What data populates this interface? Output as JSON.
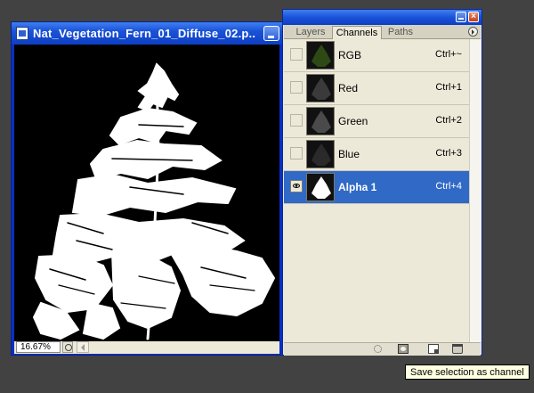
{
  "document": {
    "title": "Nat_Vegetation_Fern_01_Diffuse_02.p...",
    "zoom": "16.67%"
  },
  "palette": {
    "tabs": [
      {
        "label": "Layers",
        "active": false
      },
      {
        "label": "Channels",
        "active": true
      },
      {
        "label": "Paths",
        "active": false
      }
    ],
    "channels": [
      {
        "name": "RGB",
        "shortcut": "Ctrl+~",
        "visible": false,
        "selected": false,
        "thumb_color": "#2e4a14"
      },
      {
        "name": "Red",
        "shortcut": "Ctrl+1",
        "visible": false,
        "selected": false,
        "thumb_color": "#3a3a3a"
      },
      {
        "name": "Green",
        "shortcut": "Ctrl+2",
        "visible": false,
        "selected": false,
        "thumb_color": "#4a4a4a"
      },
      {
        "name": "Blue",
        "shortcut": "Ctrl+3",
        "visible": false,
        "selected": false,
        "thumb_color": "#2a2a2a"
      },
      {
        "name": "Alpha 1",
        "shortcut": "Ctrl+4",
        "visible": true,
        "selected": true,
        "thumb_color": "#ffffff"
      }
    ]
  },
  "tooltip": {
    "text": "Save selection as channel"
  },
  "colors": {
    "titlebar": "#1a52d8",
    "selection": "#3169c6",
    "panel_bg": "#ece9d8",
    "desktop": "#424242"
  }
}
